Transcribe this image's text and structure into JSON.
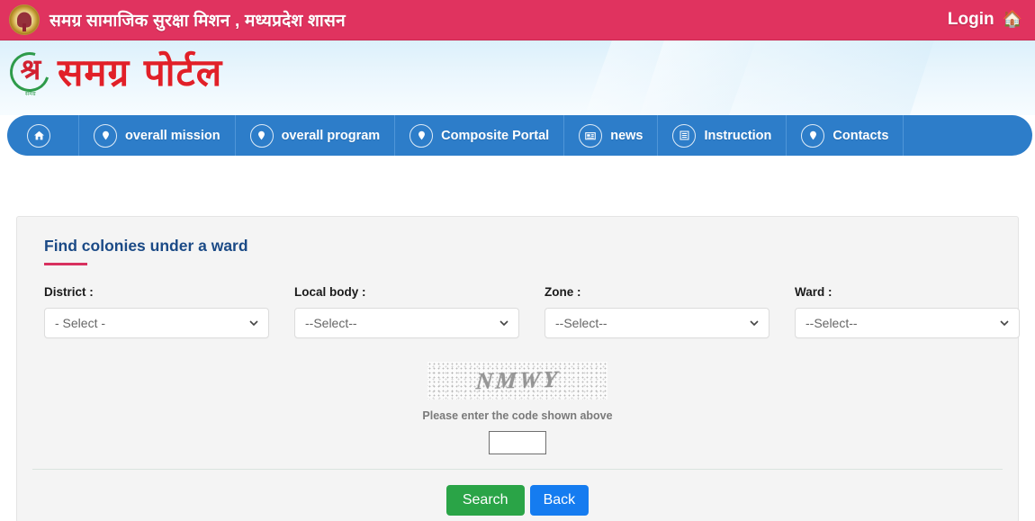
{
  "topbar": {
    "emblem_icon": "mp-government-emblem",
    "title": "समग्र सामाजिक सुरक्षा मिशन , मध्यप्रदेश शासन",
    "login_label": "Login",
    "home_icon": "home-icon",
    "background_color": "#e0335f"
  },
  "brand": {
    "mark_char": "श्र",
    "mark_sub": "समग्र",
    "title": "समग्र पोर्टल",
    "title_color": "#e12028"
  },
  "nav": {
    "background_color": "#2d7dc9",
    "items": [
      {
        "label": "",
        "icon": "home-icon"
      },
      {
        "label": "overall mission",
        "icon": "location-pin-icon"
      },
      {
        "label": "overall program",
        "icon": "location-pin-icon"
      },
      {
        "label": "Composite Portal",
        "icon": "location-pin-icon"
      },
      {
        "label": "news",
        "icon": "newspaper-icon"
      },
      {
        "label": "Instruction",
        "icon": "list-icon"
      },
      {
        "label": "Contacts",
        "icon": "map-marker-icon"
      }
    ]
  },
  "card": {
    "title": "Find colonies under a ward",
    "title_color": "#1b4a86",
    "accent_color": "#d8315f",
    "fields": [
      {
        "label": "District :",
        "value": "- Select -",
        "name": "district"
      },
      {
        "label": "Local body :",
        "value": "--Select--",
        "name": "local-body"
      },
      {
        "label": "Zone :",
        "value": "--Select--",
        "name": "zone"
      },
      {
        "label": "Ward :",
        "value": "--Select--",
        "name": "ward"
      }
    ],
    "captcha": {
      "code_text": "NMWY",
      "hint": "Please enter the code shown above",
      "input_value": "",
      "input_placeholder": ""
    },
    "buttons": {
      "search_label": "Search",
      "search_color": "#2aa447",
      "back_label": "Back",
      "back_color": "#157cf0"
    }
  }
}
